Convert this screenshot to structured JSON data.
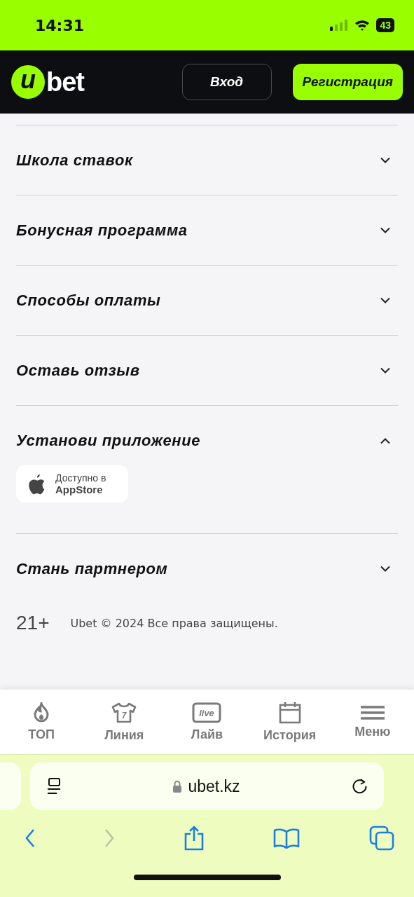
{
  "status_bar": {
    "time": "14:31",
    "battery": "43"
  },
  "header": {
    "logo": {
      "mark": "u",
      "word": "bet"
    },
    "login": "Вход",
    "register": "Регистрация"
  },
  "sections": [
    {
      "title": "Школа ставок",
      "expanded": false
    },
    {
      "title": "Бонусная программа",
      "expanded": false
    },
    {
      "title": "Способы оплаты",
      "expanded": false
    },
    {
      "title": "Оставь отзыв",
      "expanded": false
    },
    {
      "title": "Установи приложение",
      "expanded": true,
      "badge": {
        "line1": "Доступно в",
        "line2": "AppStore"
      }
    },
    {
      "title": "Стань партнером",
      "expanded": false
    }
  ],
  "footer": {
    "age": "21+",
    "copyright": "Ubet © 2024 Все права защищены."
  },
  "tab_bar": [
    {
      "kind": "flame",
      "label": "ТОП"
    },
    {
      "kind": "shirt",
      "label": "Линия",
      "icon_text": "7"
    },
    {
      "kind": "live",
      "label": "Лайв",
      "icon_text": "live"
    },
    {
      "kind": "calendar",
      "label": "История"
    },
    {
      "kind": "menu",
      "label": "Меню"
    }
  ],
  "browser": {
    "url": "ubet.kz"
  }
}
